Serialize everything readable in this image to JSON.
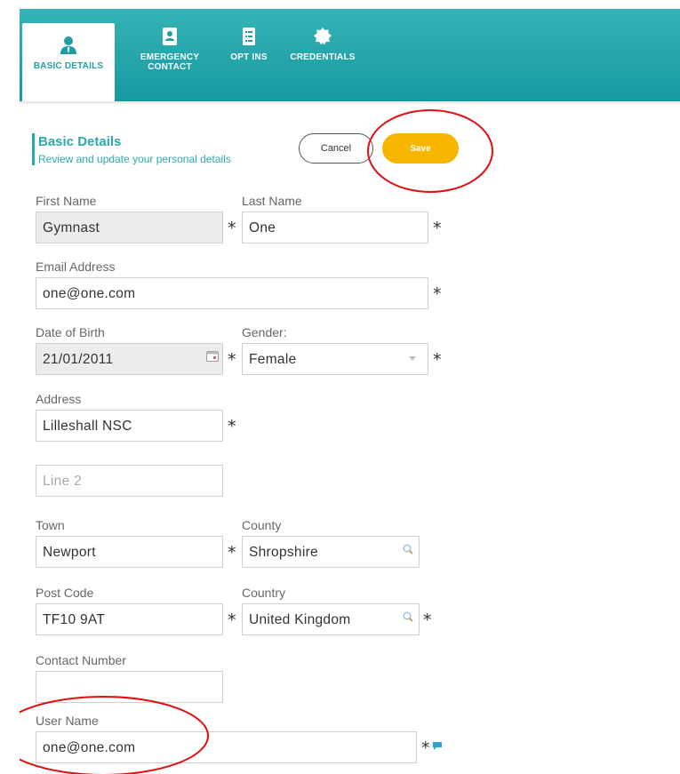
{
  "tabs": [
    {
      "label": "BASIC DETAILS",
      "icon": "person-icon",
      "active": true
    },
    {
      "label": "EMERGENCY CONTACT",
      "icon": "contact-card-icon",
      "active": false
    },
    {
      "label": "OPT INS",
      "icon": "checklist-icon",
      "active": false
    },
    {
      "label": "CREDENTIALS",
      "icon": "badge-icon",
      "active": false
    }
  ],
  "section": {
    "title": "Basic Details",
    "subtitle": "Review and update your personal details"
  },
  "actions": {
    "cancel": "Cancel",
    "save": "Save"
  },
  "form": {
    "first_name": {
      "label": "First Name",
      "value": "Gymnast",
      "required": "*"
    },
    "last_name": {
      "label": "Last Name",
      "value": "One",
      "required": "*"
    },
    "email": {
      "label": "Email Address",
      "value": "one@one.com",
      "required": "*"
    },
    "dob": {
      "label": "Date of Birth",
      "value": "21/01/2011",
      "required": "*"
    },
    "gender": {
      "label": "Gender:",
      "value": "Female",
      "required": "*"
    },
    "address": {
      "label": "Address",
      "line1": "Lilleshall NSC",
      "line2_placeholder": "Line 2",
      "required": "*"
    },
    "town": {
      "label": "Town",
      "value": "Newport",
      "required": "*"
    },
    "county": {
      "label": "County",
      "value": "Shropshire"
    },
    "post_code": {
      "label": "Post Code",
      "value": "TF10 9AT",
      "required": "*"
    },
    "country": {
      "label": "Country",
      "value": "United Kingdom",
      "required": "*"
    },
    "contact_number": {
      "label": "Contact Number",
      "value": ""
    },
    "user_name": {
      "label": "User Name",
      "value": "one@one.com",
      "required": "*"
    }
  },
  "colors": {
    "teal": "#2aa9ae",
    "save": "#f7b500",
    "annotation": "#e01010"
  }
}
